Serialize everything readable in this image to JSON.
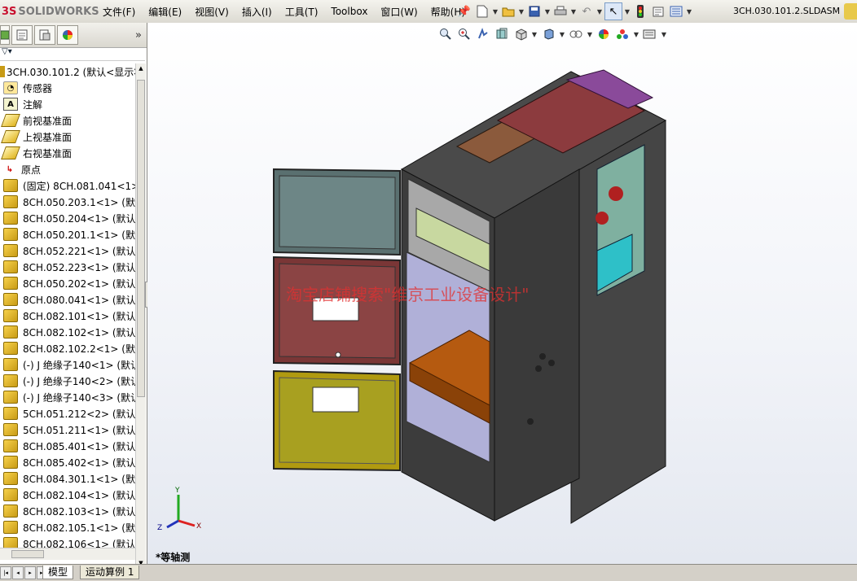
{
  "app": {
    "logo_ds": "3S",
    "logo_name": "SOLIDWORKS",
    "filename": "3CH.030.101.2.SLDASM"
  },
  "menu": [
    "文件(F)",
    "编辑(E)",
    "视图(V)",
    "插入(I)",
    "工具(T)",
    "Toolbox",
    "窗口(W)",
    "帮助(H)"
  ],
  "tree": {
    "root": "3CH.030.101.2  (默认<显示状",
    "items": [
      {
        "label": "传感器",
        "icon": "sensor-icon"
      },
      {
        "label": "注解",
        "icon": "annotation-icon"
      },
      {
        "label": "前视基准面",
        "icon": "plane-icon"
      },
      {
        "label": "上视基准面",
        "icon": "plane-icon"
      },
      {
        "label": "右视基准面",
        "icon": "plane-icon"
      },
      {
        "label": "原点",
        "icon": "origin-icon"
      },
      {
        "label": "(固定) 8CH.081.041<1>",
        "icon": "part-icon"
      },
      {
        "label": "8CH.050.203.1<1> (默认",
        "icon": "part-icon"
      },
      {
        "label": "8CH.050.204<1> (默认<",
        "icon": "part-icon"
      },
      {
        "label": "8CH.050.201.1<1> (默认",
        "icon": "part-icon"
      },
      {
        "label": "8CH.052.221<1> (默认<",
        "icon": "part-icon"
      },
      {
        "label": "8CH.052.223<1> (默认<",
        "icon": "part-icon"
      },
      {
        "label": "8CH.050.202<1> (默认<",
        "icon": "part-icon"
      },
      {
        "label": "8CH.080.041<1> (默认<",
        "icon": "part-icon"
      },
      {
        "label": "8CH.082.101<1> (默认<",
        "icon": "part-icon"
      },
      {
        "label": "8CH.082.102<1> (默认<",
        "icon": "part-icon"
      },
      {
        "label": "8CH.082.102.2<1> (默认",
        "icon": "part-icon"
      },
      {
        "label": "(-) J 绝缘子140<1> (默认",
        "icon": "part-icon"
      },
      {
        "label": "(-) J 绝缘子140<2> (默认",
        "icon": "part-icon"
      },
      {
        "label": "(-) J 绝缘子140<3> (默认",
        "icon": "part-icon"
      },
      {
        "label": "5CH.051.212<2> (默认<",
        "icon": "part-icon"
      },
      {
        "label": "5CH.051.211<1> (默认<",
        "icon": "part-icon"
      },
      {
        "label": "8CH.085.401<1> (默认<",
        "icon": "part-icon"
      },
      {
        "label": "8CH.085.402<1> (默认<",
        "icon": "part-icon"
      },
      {
        "label": "8CH.084.301.1<1> (默认",
        "icon": "part-icon"
      },
      {
        "label": "8CH.082.104<1> (默认<",
        "icon": "part-icon"
      },
      {
        "label": "8CH.082.103<1> (默认<",
        "icon": "part-icon"
      },
      {
        "label": "8CH.082.105.1<1> (默认",
        "icon": "part-icon"
      },
      {
        "label": "8CH.082.106<1> (默认<",
        "icon": "part-icon"
      }
    ]
  },
  "viewport": {
    "watermark": "淘宝店铺搜索\"维京工业设备设计\"",
    "view_name": "*等轴测",
    "triad": {
      "x": "X",
      "y": "Y",
      "z": "Z"
    }
  },
  "bottom_tabs": [
    "模型",
    "运动算例 1"
  ]
}
